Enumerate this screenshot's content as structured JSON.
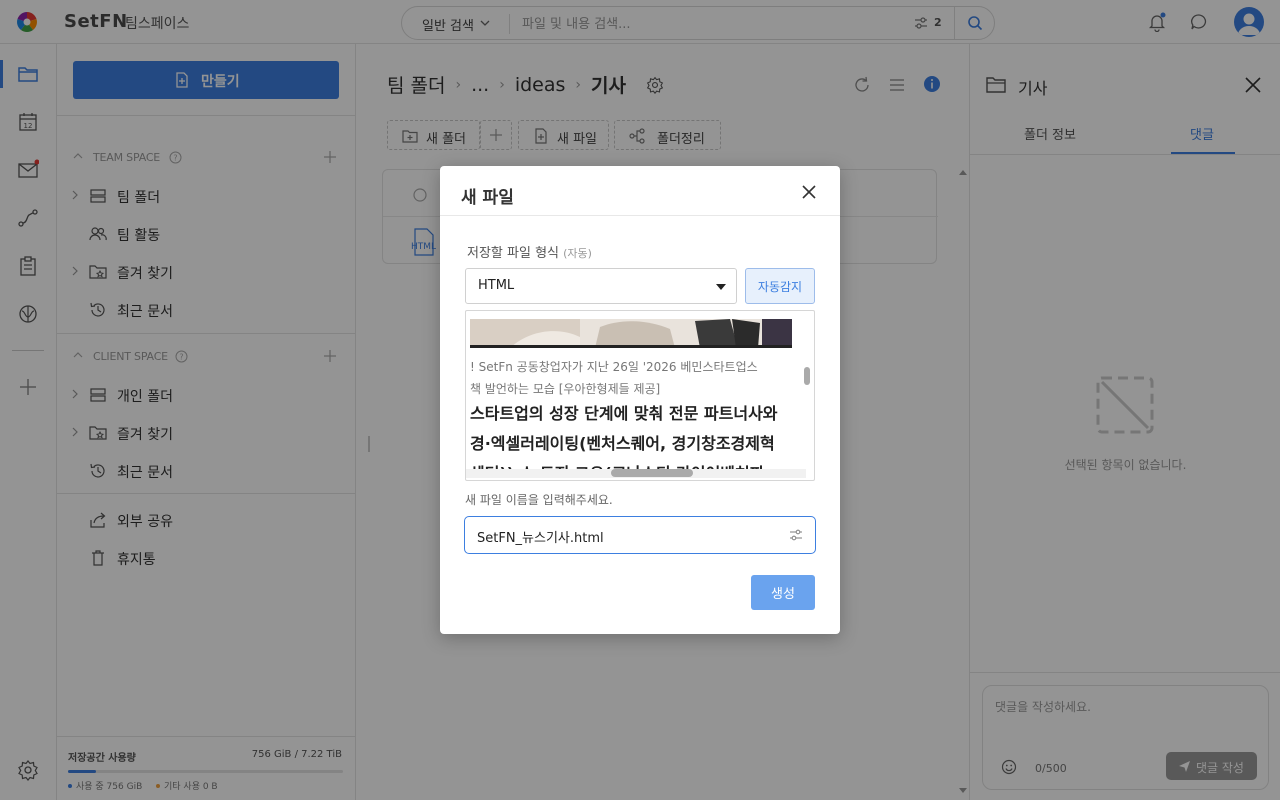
{
  "app": {
    "brand": "SetFN",
    "workspace": "팀스페이스"
  },
  "search": {
    "mode": "일반 검색",
    "placeholder": "파일 및 내용 검색...",
    "filter_count": "2"
  },
  "sidebar": {
    "create_label": "만들기",
    "team_space": {
      "title": "TEAM SPACE",
      "items": [
        {
          "label": "팀 폴더"
        },
        {
          "label": "팀 활동"
        },
        {
          "label": "즐겨 찾기"
        },
        {
          "label": "최근 문서"
        }
      ]
    },
    "client_space": {
      "title": "CLIENT SPACE",
      "items": [
        {
          "label": "개인 폴더"
        },
        {
          "label": "즐겨 찾기"
        },
        {
          "label": "최근 문서"
        }
      ]
    },
    "extra_items": [
      {
        "label": "외부 공유"
      },
      {
        "label": "휴지통"
      }
    ],
    "storage": {
      "label": "저장공간 사용량",
      "value": "756 GiB / 7.22 TiB",
      "used_fraction": 0.1,
      "legend_used": "사용 중 756 GiB",
      "legend_other": "기타 사용 0 B",
      "used_color": "#3d7fe0",
      "other_color": "#f0a040"
    }
  },
  "main": {
    "breadcrumb": [
      "팀 폴더",
      "...",
      "ideas",
      "기사"
    ],
    "toolbar": {
      "new_folder": "새 폴더",
      "new_file": "새 파일",
      "organize": "폴더정리"
    },
    "file_badge": "HTML"
  },
  "right_panel": {
    "title": "기사",
    "tabs": [
      {
        "label": "폴더 정보"
      },
      {
        "label": "댓글"
      }
    ],
    "empty_text": "선택된 항목이 없습니다.",
    "comment_placeholder": "댓글을 작성하세요.",
    "comment_count": "0/500",
    "comment_button": "댓글 작성"
  },
  "modal": {
    "title": "새 파일",
    "format_label": "저장할 파일 형식",
    "format_sub": "(자동)",
    "format_value": "HTML",
    "auto_detect": "자동감지",
    "preview": {
      "caption_line1": "! SetFn 공동창업자가 지난 26일 '2026 베민스타트업스",
      "caption_line2": "책 발언하는 모습 [우아한형제들 제공]",
      "body_line1": " 스타트업의 성장 단계에 맞춰 전문 파트너사와",
      "body_line2": "경·엑셀러레이팅(벤처스퀘어, 경기창조경제혁",
      "body_line3": "센터)) 스 트지 그오(코나스티 라이어벤처파"
    },
    "name_label": "새 파일 이름을 입력해주세요.",
    "name_value": "SetFN_뉴스기사.html",
    "create_button": "생성"
  },
  "colors": {
    "accent": "#3d7fe0",
    "notification_dot": "#e53935"
  }
}
